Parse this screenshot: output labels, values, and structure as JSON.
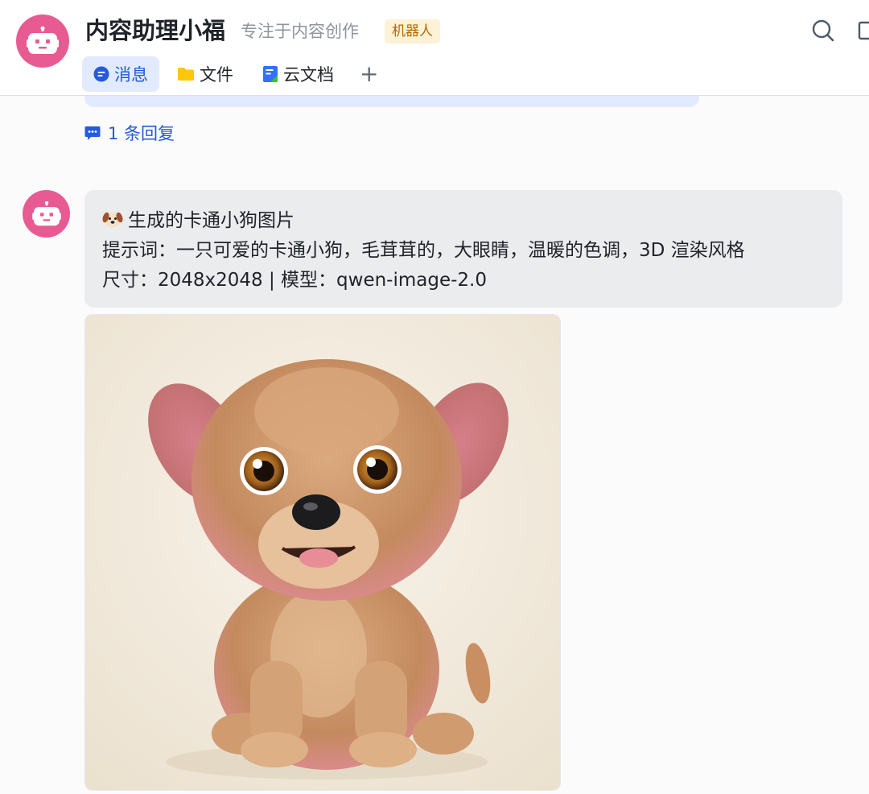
{
  "header": {
    "bot_name": "内容助理小福",
    "bot_description": "专注于内容创作",
    "bot_badge": "机器人",
    "tabs": [
      {
        "label": "消息",
        "icon": "chat-bubble-icon",
        "active": true
      },
      {
        "label": "文件",
        "icon": "folder-icon",
        "active": false
      },
      {
        "label": "云文档",
        "icon": "cloud-doc-icon",
        "active": false
      }
    ],
    "add_tab_label": "+"
  },
  "thread": {
    "reply_count_label": "1 条回复"
  },
  "message": {
    "title": "生成的卡通小狗图片",
    "prompt_line": "提示词：一只可爱的卡通小狗，毛茸茸的，大眼睛，温暖的色调，3D 渲染风格",
    "meta_line": "尺寸：2048x2048 | 模型：qwen-image-2.0",
    "image_alt": "cartoon-puppy-image"
  },
  "colors": {
    "accent": "#245bdb",
    "active_tab_bg": "#e1eaff",
    "avatar": "#e85b92",
    "bubble_bg": "#ebecee",
    "badge_bg": "#fdf2d6",
    "badge_text": "#b26a00"
  }
}
